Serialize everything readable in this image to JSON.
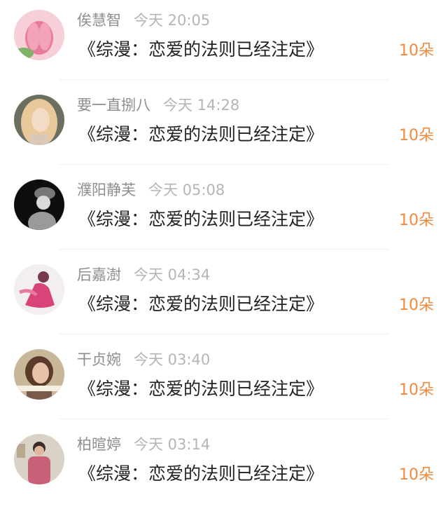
{
  "gift_list": [
    {
      "name": "俟慧智",
      "time": "今天 20:05",
      "book": "《综漫：恋爱的法则已经注定》",
      "count": "10朵",
      "avatar_icon": "lotus-flower-avatar",
      "avatar_colors": [
        "#f6cfd8",
        "#e87a9a",
        "#7fb36a"
      ]
    },
    {
      "name": "要一直捌八",
      "time": "今天 14:28",
      "book": "《综漫：恋爱的法则已经注定》",
      "count": "10朵",
      "avatar_icon": "blonde-girl-avatar",
      "avatar_colors": [
        "#6b6f60",
        "#e9c89a",
        "#f3dcc5"
      ]
    },
    {
      "name": "濮阳静芙",
      "time": "今天 05:08",
      "book": "《综漫：恋爱的法则已经注定》",
      "count": "10朵",
      "avatar_icon": "person-with-hat-avatar",
      "avatar_colors": [
        "#0e0e0e",
        "#d9d9d9",
        "#777777"
      ]
    },
    {
      "name": "后嘉澍",
      "time": "今天 04:34",
      "book": "《综漫：恋爱的法则已经注定》",
      "count": "10朵",
      "avatar_icon": "pink-dress-avatar",
      "avatar_colors": [
        "#f3eef0",
        "#d8437a",
        "#7a3a4d"
      ]
    },
    {
      "name": "干贞婉",
      "time": "今天 03:40",
      "book": "《综漫：恋爱的法则已经注定》",
      "count": "10朵",
      "avatar_icon": "girl-with-text-avatar",
      "avatar_colors": [
        "#c9b79a",
        "#5a3b2a",
        "#e8c2a8"
      ]
    },
    {
      "name": "柏暄婷",
      "time": "今天 03:14",
      "book": "《综漫：恋爱的法则已经注定》",
      "count": "10朵",
      "avatar_icon": "elderly-woman-avatar",
      "avatar_colors": [
        "#d9d2c7",
        "#c9607a",
        "#3a2e2a"
      ]
    }
  ]
}
